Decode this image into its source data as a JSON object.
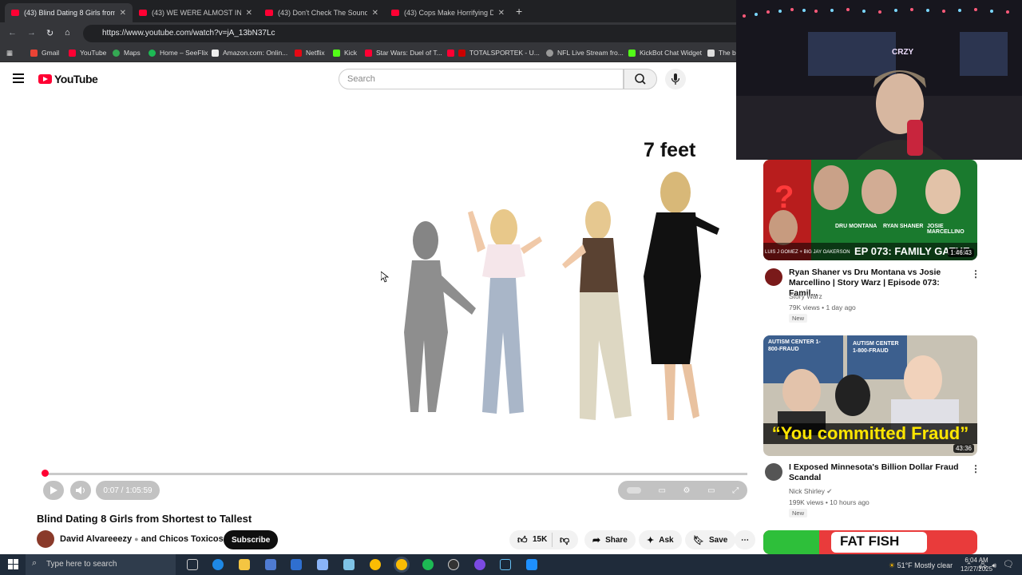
{
  "browser": {
    "tabs": [
      {
        "title": "(43) Blind Dating 8 Girls from S",
        "active": true
      },
      {
        "title": "(43) WE WERE ALMOST IN TEA",
        "active": false
      },
      {
        "title": "(43) Don't Check The Sound 👀",
        "active": false
      },
      {
        "title": "(43) Cops Make Horrifying Disc",
        "active": false
      }
    ],
    "url": "https://www.youtube.com/watch?v=jA_13bN37Lc",
    "bookmarks": [
      "Gmail",
      "YouTube",
      "Maps",
      "Home – SeeFlix",
      "Amazon.com: Onlin...",
      "Netflix",
      "Kick",
      "Star Wars: Duel of T...",
      "TOTALSPORTEK - U...",
      "NFL Live Stream fro...",
      "KickBot Chat Widget",
      "The be"
    ]
  },
  "youtube": {
    "logo_text": "YouTube",
    "search_placeholder": "Search"
  },
  "player": {
    "overlay_text": "7 feet",
    "time": "0:07 / 1:05:59",
    "progress": 0.002
  },
  "video": {
    "title": "Blind Dating 8 Girls from Shortest to Tallest",
    "channel": "David Alvareeezy",
    "channel_and": "and",
    "channel2": "Chicos Toxicos",
    "subscribe_label": "Subscribe",
    "likes": "15K",
    "share_label": "Share",
    "ask_label": "Ask",
    "save_label": "Save"
  },
  "webcam": {
    "label": "CRZY"
  },
  "recommendations": [
    {
      "title": "Ryan Shaner vs Dru Montana vs Josie Marcellino | Story Warz | Episode 073: Famil...",
      "channel": "Story Warz",
      "meta": "79K views • 1 day ago",
      "badge": "New",
      "duration": "1:46:43",
      "thumb_text": "EP 073: FAMILY GATHE",
      "thumb_names": [
        "DRU MONTANA",
        "RYAN SHANER",
        "JOSIE MARCELLINO"
      ],
      "thumb_small": "LUIS J GOMEZ + BIG JAY OAKERSON"
    },
    {
      "title": "I Exposed Minnesota's Billion Dollar Fraud Scandal",
      "channel": "Nick Shirley",
      "meta": "199K views • 10 hours ago",
      "badge": "New",
      "duration": "43:36",
      "thumb_text": "“You committed Fraud”",
      "thumb_sign1": "AUTISM CENTER 1-800-FRAUD",
      "thumb_sign2": "AUTISM CENTER 1-800-FRAUD"
    },
    {
      "thumb_text": "FAT FISH"
    }
  ],
  "taskbar": {
    "search_placeholder": "Type here to search",
    "weather": "51°F  Mostly clear",
    "time": "6:04 AM",
    "date": "12/27/2025"
  }
}
